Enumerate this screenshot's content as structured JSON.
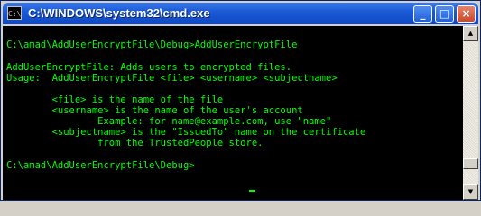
{
  "window": {
    "title": "C:\\WINDOWS\\system32\\cmd.exe",
    "icon_name": "cmd-icon",
    "buttons": {
      "minimize": "_",
      "maximize": "□",
      "close": "×"
    }
  },
  "colors": {
    "console_bg": "#000000",
    "console_fg": "#00ff00",
    "titlebar": "#0f47c4"
  },
  "console": {
    "lines": [
      "C:\\amad\\AddUserEncryptFile\\Debug>AddUserEncryptFile",
      "AddUserEncryptFile: Adds users to encrypted files.",
      "Usage:  AddUserEncryptFile <file> <username> <subjectname>",
      "        <file> is the name of the file",
      "        <username> is the name of the user's account",
      "                Example: for name@example.com, use \"name\"",
      "        <subjectname> is the \"IssuedTo\" name on the certificate",
      "                from the TrustedPeople store.",
      "C:\\amad\\AddUserEncryptFile\\Debug>"
    ]
  },
  "scrollbar": {
    "up_arrow": "▲",
    "down_arrow": "▼"
  }
}
